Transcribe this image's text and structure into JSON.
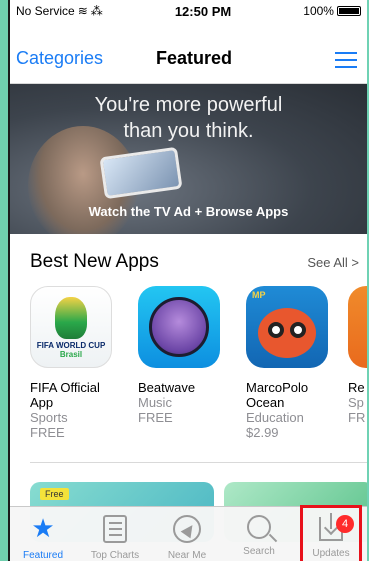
{
  "status_bar": {
    "carrier": "No Service",
    "time": "12:50 PM",
    "battery": "100%"
  },
  "nav": {
    "left": "Categories",
    "title": "Featured",
    "right_icon": "list-icon"
  },
  "hero": {
    "line1": "You're more powerful",
    "line2": "than you think.",
    "cta": "Watch the TV Ad + Browse Apps"
  },
  "section": {
    "title": "Best New Apps",
    "see_all": "See All >"
  },
  "apps": [
    {
      "name": "FIFA Official App",
      "category": "Sports",
      "price": "FREE",
      "icon_text_1": "FIFA WORLD CUP",
      "icon_text_2": "Brasil"
    },
    {
      "name": "Beatwave",
      "category": "Music",
      "price": "FREE"
    },
    {
      "name": "MarcoPolo Ocean",
      "category": "Education",
      "price": "$2.99",
      "icon_text": "MP"
    },
    {
      "name": "Re Sp",
      "category": "Sp",
      "price": "FR"
    }
  ],
  "banner": {
    "tag": "Free"
  },
  "tabs": [
    {
      "label": "Featured",
      "icon": "star-icon",
      "active": true
    },
    {
      "label": "Top Charts",
      "icon": "list-icon",
      "active": false
    },
    {
      "label": "Near Me",
      "icon": "location-icon",
      "active": false
    },
    {
      "label": "Search",
      "icon": "search-icon",
      "active": false
    },
    {
      "label": "Updates",
      "icon": "updates-icon",
      "active": false,
      "badge": "4"
    }
  ],
  "colors": {
    "accent": "#1a7cf5",
    "badge": "#ff2b2b",
    "highlight": "#e8111b"
  }
}
